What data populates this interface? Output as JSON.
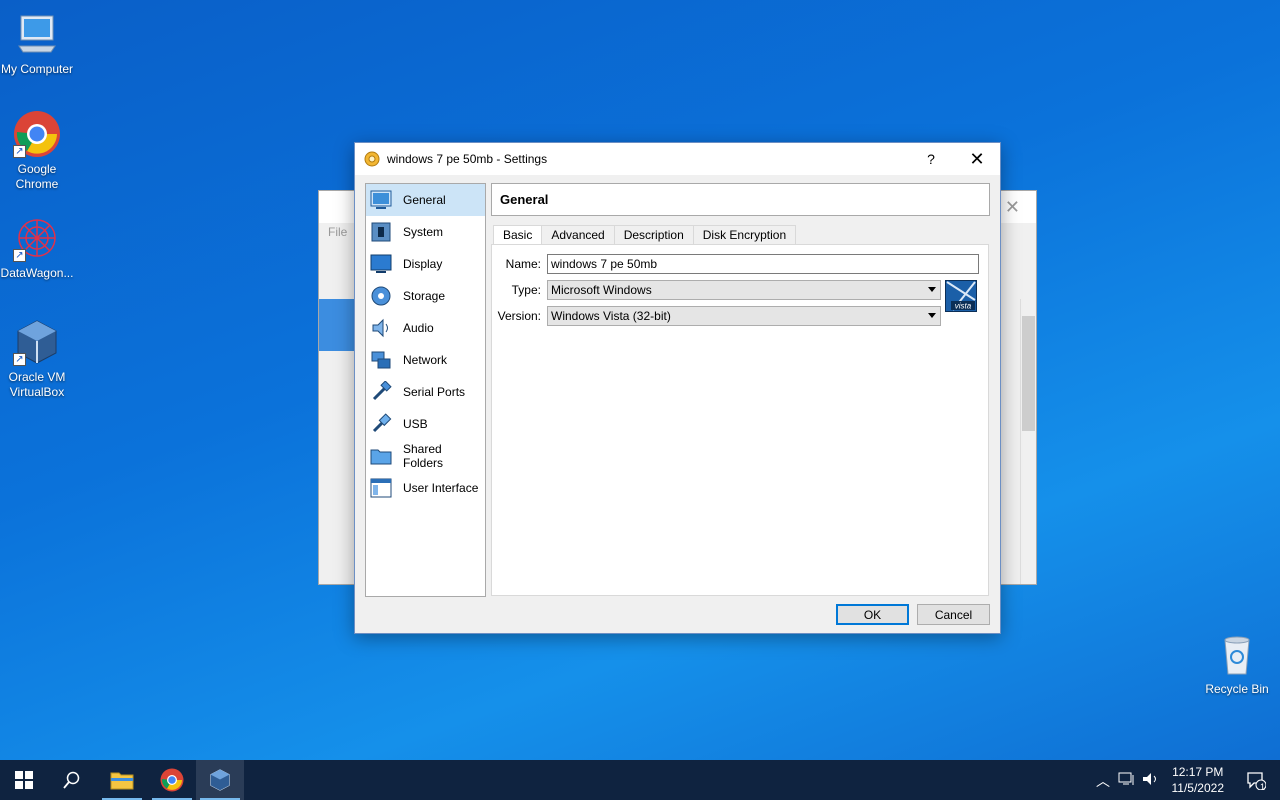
{
  "desktop": {
    "icons": [
      {
        "label": "My Computer",
        "icon": "computer-icon"
      },
      {
        "label": "Google Chrome",
        "icon": "chrome-icon"
      },
      {
        "label": "DataWagon...",
        "icon": "datawagon-icon"
      },
      {
        "label": "Oracle VM VirtualBox",
        "icon": "virtualbox-icon"
      },
      {
        "label": "Recycle Bin",
        "icon": "recycle-bin-icon"
      }
    ]
  },
  "background_window": {
    "menu_file": "File"
  },
  "dialog": {
    "title": "windows 7 pe 50mb - Settings",
    "help_label": "?",
    "close_label": "✕",
    "sidebar": [
      {
        "label": "General",
        "icon": "general-icon",
        "active": true
      },
      {
        "label": "System",
        "icon": "system-icon"
      },
      {
        "label": "Display",
        "icon": "display-icon"
      },
      {
        "label": "Storage",
        "icon": "storage-icon"
      },
      {
        "label": "Audio",
        "icon": "audio-icon"
      },
      {
        "label": "Network",
        "icon": "network-icon"
      },
      {
        "label": "Serial Ports",
        "icon": "serial-ports-icon"
      },
      {
        "label": "USB",
        "icon": "usb-icon"
      },
      {
        "label": "Shared Folders",
        "icon": "shared-folders-icon"
      },
      {
        "label": "User Interface",
        "icon": "user-interface-icon"
      }
    ],
    "section_title": "General",
    "tabs": [
      {
        "label": "Basic",
        "active": true
      },
      {
        "label": "Advanced"
      },
      {
        "label": "Description"
      },
      {
        "label": "Disk Encryption"
      }
    ],
    "form": {
      "name_label": "Name:",
      "name_value": "windows 7 pe 50mb",
      "type_label": "Type:",
      "type_value": "Microsoft Windows",
      "version_label": "Version:",
      "version_value": "Windows Vista (32-bit)",
      "os_badge": "vista"
    },
    "buttons": {
      "ok": "OK",
      "cancel": "Cancel"
    }
  },
  "taskbar": {
    "time": "12:17 PM",
    "date": "11/5/2022",
    "notification_count": "1",
    "accent": "#76b9ed"
  }
}
